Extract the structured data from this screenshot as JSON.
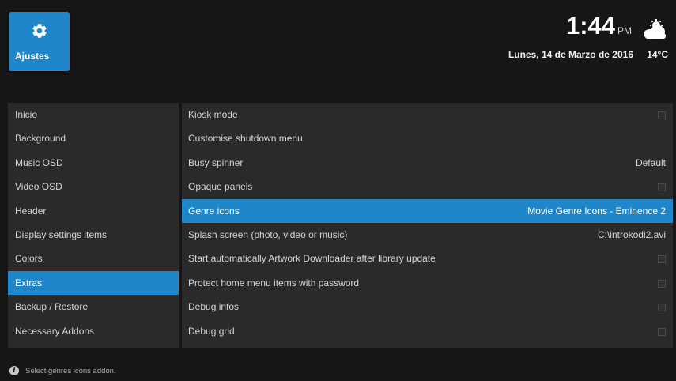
{
  "header": {
    "tile_label": "Ajustes",
    "tile_icon": "gear-icon",
    "time": "1:44",
    "ampm": "PM",
    "date": "Lunes, 14 de Marzo de 2016",
    "temperature": "14°C",
    "weather_icon": "partly-cloudy-icon"
  },
  "sidebar": {
    "items": [
      {
        "label": "Inicio"
      },
      {
        "label": "Background"
      },
      {
        "label": "Music OSD"
      },
      {
        "label": "Video OSD"
      },
      {
        "label": "Header"
      },
      {
        "label": "Display settings items"
      },
      {
        "label": "Colors"
      },
      {
        "label": "Extras"
      },
      {
        "label": "Backup / Restore"
      },
      {
        "label": "Necessary Addons"
      }
    ],
    "active_index": 7
  },
  "settings": {
    "rows": [
      {
        "label": "Kiosk mode",
        "type": "checkbox",
        "checked": false
      },
      {
        "label": "Customise shutdown menu",
        "type": "action"
      },
      {
        "label": "Busy spinner",
        "type": "value",
        "value": "Default"
      },
      {
        "label": "Opaque panels",
        "type": "checkbox",
        "checked": false
      },
      {
        "label": "Genre icons",
        "type": "value",
        "value": "Movie Genre Icons - Eminence 2"
      },
      {
        "label": "Splash screen (photo, video or music)",
        "type": "value",
        "value": "C:\\introkodi2.avi"
      },
      {
        "label": "Start automatically Artwork Downloader after library update",
        "type": "checkbox",
        "checked": false
      },
      {
        "label": "Protect home menu items with password",
        "type": "checkbox",
        "checked": false
      },
      {
        "label": "Debug infos",
        "type": "checkbox",
        "checked": false
      },
      {
        "label": "Debug grid",
        "type": "checkbox",
        "checked": false
      }
    ],
    "active_index": 4
  },
  "footer": {
    "info_icon": "info-icon",
    "hint": "Select genres icons addon."
  },
  "colors": {
    "accent": "#1f86c9",
    "background": "#161616",
    "panel": "#2a2a2a"
  }
}
